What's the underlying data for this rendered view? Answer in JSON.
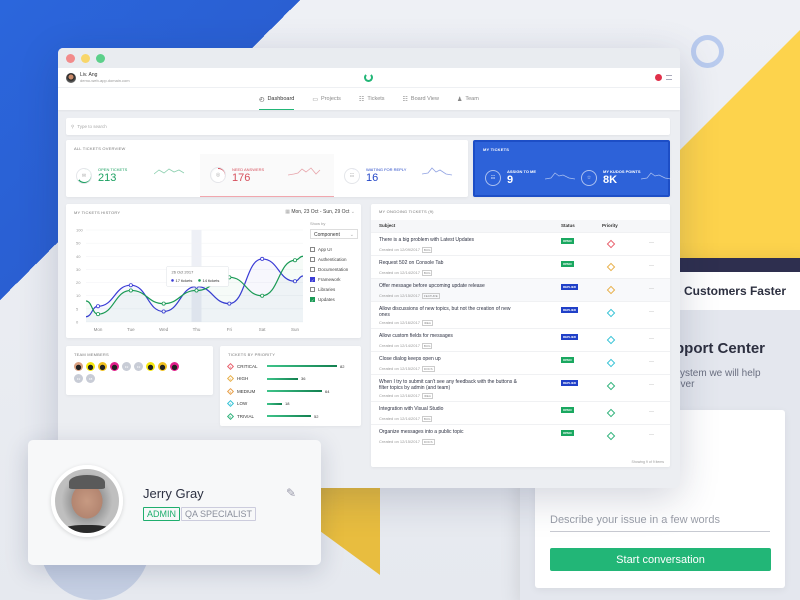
{
  "window": {
    "user": {
      "name": "Liv. Ang",
      "domain": "demo-web-app.domain.com"
    },
    "nav": [
      {
        "label": "Dashboard",
        "icon": "dashboard-icon",
        "active": true
      },
      {
        "label": "Projects",
        "icon": "folder-icon",
        "active": false
      },
      {
        "label": "Tickets",
        "icon": "ticket-icon",
        "active": false
      },
      {
        "label": "Board View",
        "icon": "grid-icon",
        "active": false
      },
      {
        "label": "Team",
        "icon": "team-icon",
        "active": false
      }
    ],
    "search_placeholder": "Type to search"
  },
  "overview": {
    "title": "ALL TICKETS OVERVIEW",
    "stats": [
      {
        "label": "OPEN TICKETS",
        "value": "213",
        "color": "#1aa060",
        "progress": 0.65
      },
      {
        "label": "NEED ANSWERS",
        "value": "176",
        "color": "#d64f5c",
        "progress": 0.45
      },
      {
        "label": "WAITING FOR REPLY",
        "value": "16",
        "color": "#2447c7",
        "progress": 0.15
      }
    ]
  },
  "my_tickets": {
    "title": "MY TICKETS",
    "stats": [
      {
        "label": "ASSIGN TO ME",
        "value": "9"
      },
      {
        "label": "MY KUDOS POINTS",
        "value": "8K"
      }
    ]
  },
  "history": {
    "title": "MY TICKETS HISTORY",
    "date_range": "Mon, 23 Oct - Sun, 29 Oct",
    "show_by_label": "Show by",
    "show_by_value": "Component",
    "filters": [
      {
        "label": "App UI",
        "checked": false,
        "color": ""
      },
      {
        "label": "Authentication",
        "checked": false,
        "color": ""
      },
      {
        "label": "Documentation",
        "checked": false,
        "color": ""
      },
      {
        "label": "Framework",
        "checked": true,
        "color": "#3a3bd6"
      },
      {
        "label": "Libraries",
        "checked": false,
        "color": ""
      },
      {
        "label": "Updates",
        "checked": true,
        "color": "#1a9a55"
      }
    ],
    "tooltip": {
      "date": "26 Oct 2017",
      "a": "17 tickets",
      "b": "14 tickets"
    }
  },
  "chart_data": {
    "type": "line",
    "title": "MY TICKETS HISTORY",
    "categories": [
      "Mon",
      "Tue",
      "Wed",
      "Thu",
      "Fri",
      "Sat",
      "Sun"
    ],
    "y_ticks": [
      "0",
      "5",
      "10",
      "20",
      "30",
      "40",
      "50",
      "100"
    ],
    "series": [
      {
        "name": "Framework",
        "color": "#3a3bd6",
        "values": [
          6,
          18,
          4,
          17,
          7,
          38,
          21
        ]
      },
      {
        "name": "Updates",
        "color": "#1a9a55",
        "values": [
          3,
          14,
          7,
          14,
          24,
          10,
          37
        ]
      }
    ],
    "highlight": "Thu"
  },
  "ongoing": {
    "title": "MY ONGOING TICKETS (9)",
    "columns": [
      "Subject",
      "Status",
      "Priority"
    ],
    "rows": [
      {
        "subject": "There is a big problem with Latest Updates",
        "created": "Created on 12/09/2017",
        "tag": "BUG",
        "status": "OPEN",
        "priority": "1"
      },
      {
        "subject": "Request 502 on Console Tab",
        "created": "Created on 12/14/2017",
        "tag": "BUG",
        "status": "OPEN",
        "priority": "2"
      },
      {
        "subject": "Offer message before upcoming update release",
        "created": "Created on 12/15/2017",
        "tag": "FEATURE",
        "status": "REPLIED",
        "priority": "2"
      },
      {
        "subject": "Allow discussions of new topics, but not the creation of new ones",
        "created": "Created on 12/16/2017",
        "tag": "IDEA",
        "status": "REPLIED",
        "priority": "4"
      },
      {
        "subject": "Allow custom fields for messages",
        "created": "Created on 12/14/2017",
        "tag": "BUG",
        "status": "REPLIED",
        "priority": "4"
      },
      {
        "subject": "Close dialog keeps open up",
        "created": "Created on 12/15/2017",
        "tag": "DOCS",
        "status": "OPEN",
        "priority": "4"
      },
      {
        "subject": "When I try to submit can't see any feedback with the buttons & filter topics by admin (and team)",
        "created": "Created on 12/16/2017",
        "tag": "IDEA",
        "status": "REPLIED",
        "priority": "5"
      },
      {
        "subject": "Integration with Visual Studio",
        "created": "Created on 12/14/2017",
        "tag": "BUG",
        "status": "OPEN",
        "priority": "5"
      },
      {
        "subject": "Organize messages into a public topic",
        "created": "Created on 12/15/2017",
        "tag": "DOCS",
        "status": "OPEN",
        "priority": "5"
      }
    ],
    "footer": "Showing 9 of 9 items"
  },
  "team": {
    "title": "TEAM MEMBERS",
    "members": [
      "photo",
      "avatar",
      "avatar",
      "avatar",
      "F2",
      "F2",
      "avatar",
      "avatar",
      "avatar",
      "F2",
      "F8"
    ]
  },
  "priority": {
    "title": "TICKETS BY PRIORITY",
    "items": [
      {
        "num": "1",
        "label": "CRITICAL",
        "value": 82,
        "color": "#e8606d"
      },
      {
        "num": "2",
        "label": "HIGH",
        "value": 36,
        "color": "#e8b04a"
      },
      {
        "num": "3",
        "label": "MEDIUM",
        "value": 64,
        "color": "#e8a04a"
      },
      {
        "num": "4",
        "label": "LOW",
        "value": 18,
        "color": "#36c3d6"
      },
      {
        "num": "5",
        "label": "TRIVIAL",
        "value": 52,
        "color": "#2fb27a"
      }
    ]
  },
  "profile": {
    "name": "Jerry Gray",
    "badges": [
      "ADMIN",
      "QA SPECIALIST"
    ]
  },
  "support": {
    "headline": "e Help Customers Faster",
    "title": "pport Center",
    "desc1": "system we will help",
    "desc2": "ever",
    "input_placeholder": "Describe your issue in a few words",
    "button": "Start conversation"
  }
}
